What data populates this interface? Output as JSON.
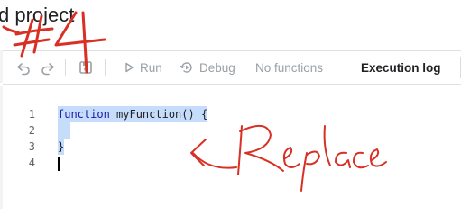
{
  "header": {
    "title": "d project"
  },
  "toolbar": {
    "undo_icon": "undo-icon",
    "redo_icon": "redo-icon",
    "save_icon": "save-icon",
    "run_label": "Run",
    "debug_label": "Debug",
    "functions_label": "No functions",
    "execution_log_label": "Execution log"
  },
  "editor": {
    "lines": [
      {
        "number": "1",
        "keyword": "function",
        "rest": " myFunction() {"
      },
      {
        "number": "2",
        "keyword": "",
        "rest": "  "
      },
      {
        "number": "3",
        "keyword": "",
        "rest": "}"
      },
      {
        "number": "4",
        "keyword": "",
        "rest": ""
      }
    ],
    "selected_lines": "1-3"
  },
  "annotations": {
    "step_marker": "#4",
    "instruction": "Replace",
    "ink_color": "#d93025"
  },
  "colors": {
    "selection": "#c5dcfb",
    "keyword": "#1a1aa6",
    "toolbar_disabled": "#9aa0a6"
  }
}
